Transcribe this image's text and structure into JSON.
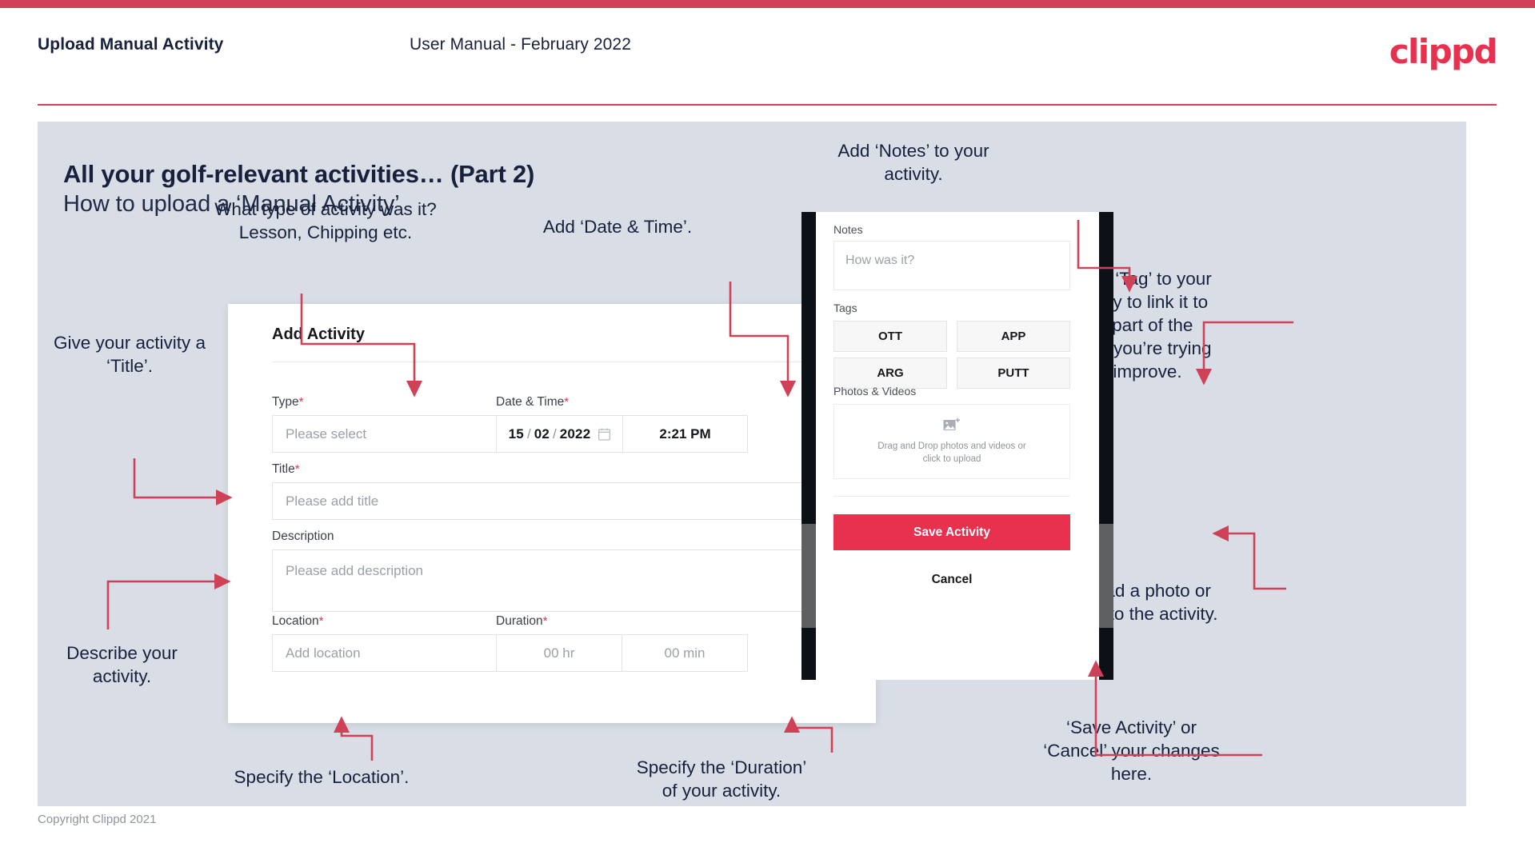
{
  "top_bar_color": "#cf4157",
  "accent_color": "#e8304f",
  "slide_bg_color": "#d9dee6",
  "header": {
    "title": "Upload Manual Activity",
    "subtitle": "User Manual - February 2022",
    "logo": "clippd"
  },
  "slide": {
    "title": "All your golf-relevant activities… (Part 2)",
    "subtitle": "How to upload a ‘Manual Activity’"
  },
  "annotations": {
    "type": "What type of activity was it?\nLesson, Chipping etc.",
    "date_time": "Add ‘Date & Time’.",
    "title": "Give your activity a\n‘Title’.",
    "describe": "Describe your\nactivity.",
    "location": "Specify the ‘Location’.",
    "duration": "Specify the ‘Duration’\nof your activity.",
    "notes": "Add ‘Notes’ to your\nactivity.",
    "tag": "Add a ‘Tag’ to your\nactivity to link it to\nthe part of the\ngame you’re trying\nto improve.",
    "upload": "Upload a photo or\nvideo to the activity.",
    "save_cancel": "‘Save Activity’ or\n‘Cancel’ your changes\nhere."
  },
  "dialog": {
    "title": "Add Activity",
    "close_label": "✕",
    "fields": {
      "type": {
        "label": "Type",
        "required": "*",
        "placeholder": "Please select"
      },
      "date_time": {
        "label": "Date & Time",
        "required": "*",
        "day": "15",
        "month": "02",
        "year": "2022",
        "separator": "/",
        "time": "2:21 PM"
      },
      "title": {
        "label": "Title",
        "required": "*",
        "placeholder": "Please add title"
      },
      "description": {
        "label": "Description",
        "required": "",
        "placeholder": "Please add description"
      },
      "location": {
        "label": "Location",
        "required": "*",
        "placeholder": "Add location"
      },
      "duration": {
        "label": "Duration",
        "required": "*",
        "hours": "00 hr",
        "minutes": "00 min"
      }
    }
  },
  "phone": {
    "notes_label": "Notes",
    "notes_placeholder": "How was it?",
    "tags_label": "Tags",
    "tags": [
      "OTT",
      "APP",
      "ARG",
      "PUTT"
    ],
    "photos_label": "Photos & Videos",
    "upload_text": "Drag and Drop photos and videos or\nclick to upload",
    "save_label": "Save Activity",
    "cancel_label": "Cancel"
  },
  "footer": {
    "copyright": "Copyright Clippd 2021"
  }
}
